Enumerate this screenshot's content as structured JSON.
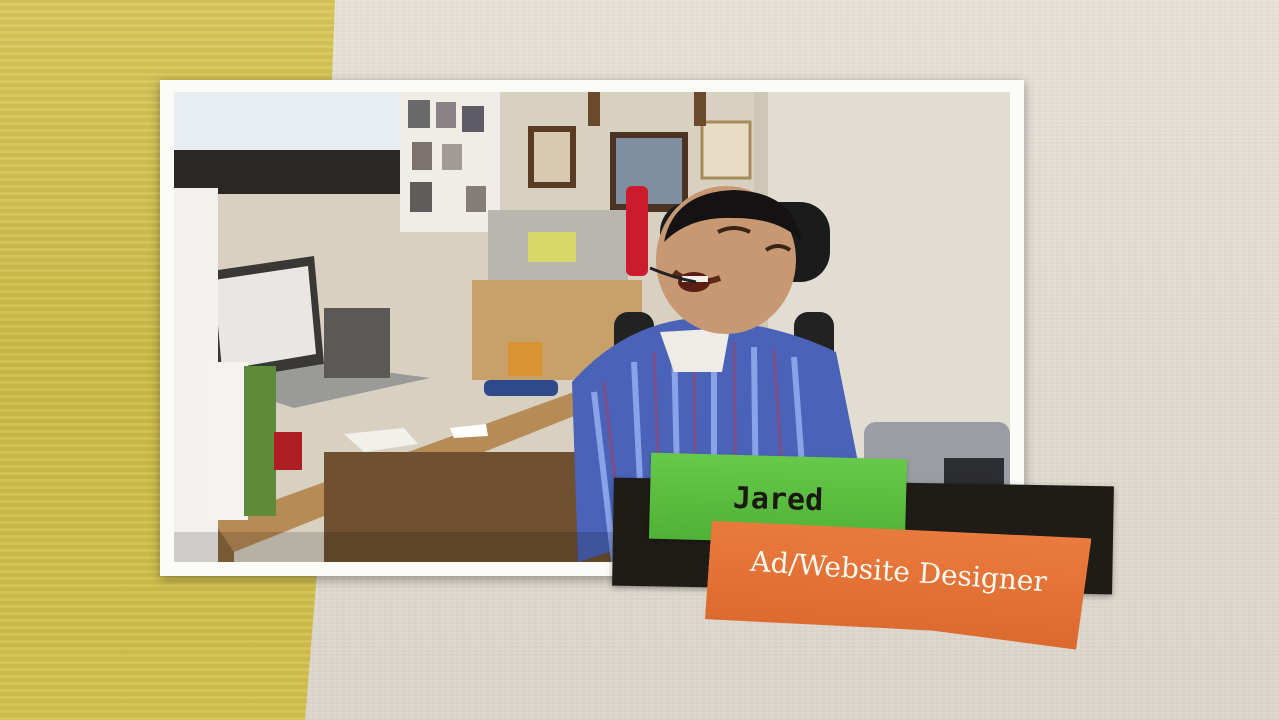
{
  "lower_third": {
    "name": "Jared",
    "title": "Ad/Website Designer"
  },
  "colors": {
    "name_tag": "#5bbd3f",
    "title_tag": "#e2703a",
    "backing": "#1f1b17",
    "left_paper": "#d3c24f",
    "right_paper": "#e4dfd6"
  }
}
